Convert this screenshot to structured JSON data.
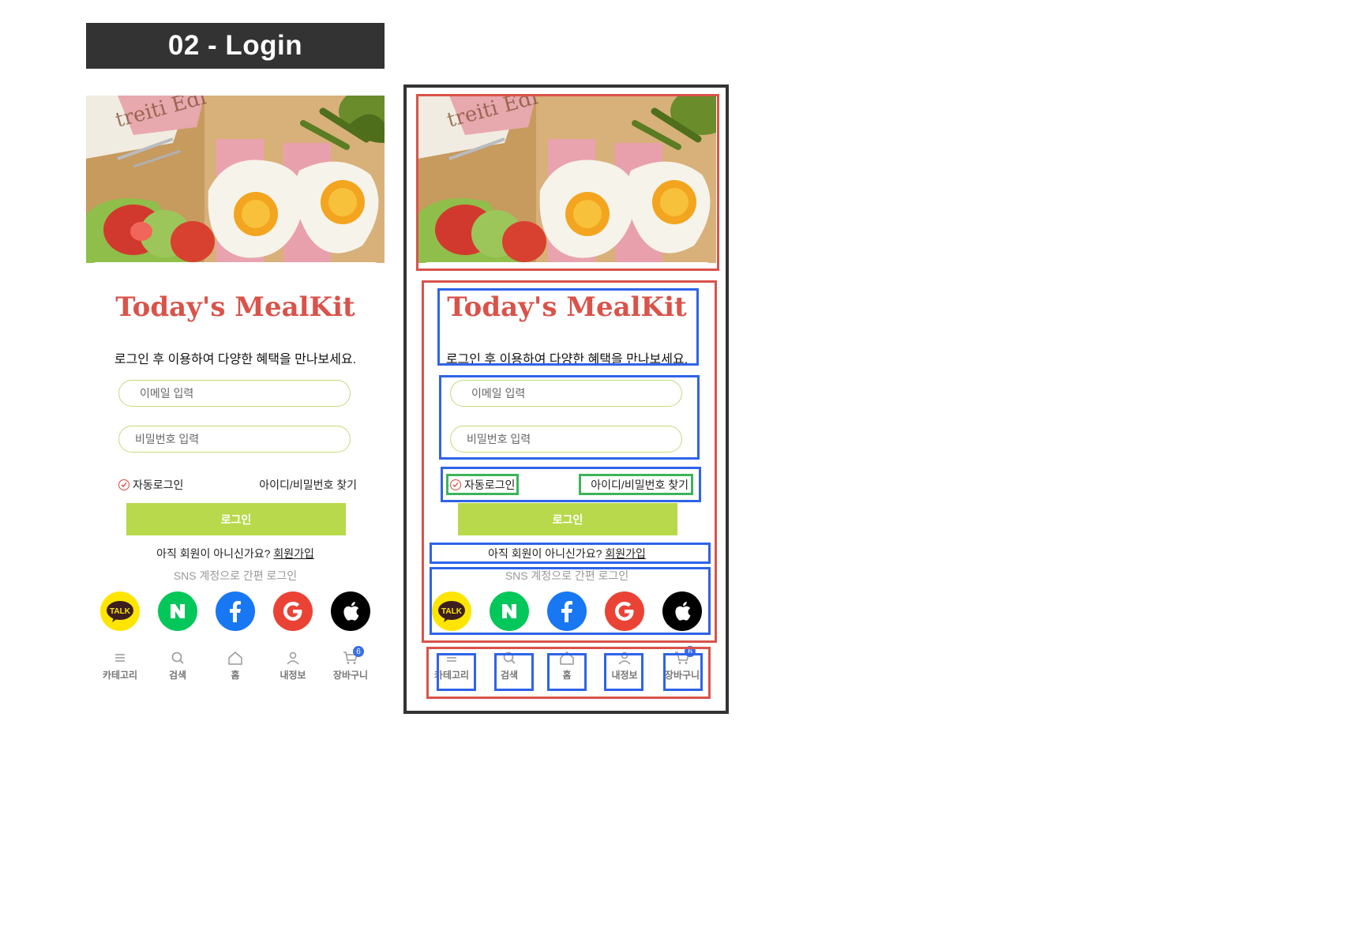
{
  "page": {
    "title": "02 - Login"
  },
  "login": {
    "brand": "Today's MealKit",
    "subtitle": "로그인 후 이용하여 다양한 혜택을 만나보세요.",
    "email_placeholder": "이메일 입력",
    "password_placeholder": "비밀번호 입력",
    "auto_login_label": "자동로그인",
    "find_account_label": "아이디/비밀번호 찾기",
    "login_button_label": "로그인",
    "signup_prompt": "아직 회원이 아니신가요?",
    "signup_link": "회원가입",
    "sns_caption": "SNS 계정으로 간편 로그인",
    "sns": [
      {
        "name": "kakao",
        "icon": "kakao-talk-icon",
        "text": "TALK",
        "color": "#fee500"
      },
      {
        "name": "naver",
        "icon": "naver-icon",
        "text": "N",
        "color": "#03c75a"
      },
      {
        "name": "facebook",
        "icon": "facebook-icon",
        "text": "f",
        "color": "#1877f2"
      },
      {
        "name": "google",
        "icon": "google-icon",
        "text": "G",
        "color": "#ea4335"
      },
      {
        "name": "apple",
        "icon": "apple-icon",
        "color": "#000000"
      }
    ]
  },
  "tabbar": {
    "items": [
      {
        "label": "카테고리",
        "icon": "menu-icon"
      },
      {
        "label": "검색",
        "icon": "search-icon"
      },
      {
        "label": "홈",
        "icon": "home-icon"
      },
      {
        "label": "내정보",
        "icon": "user-icon"
      },
      {
        "label": "장바구니",
        "icon": "cart-icon",
        "badge": "6"
      }
    ]
  },
  "colors": {
    "brand": "#d9534a",
    "accent": "#b9d94c",
    "input_border": "#c6d97a",
    "header_bg": "#333333",
    "annotation_red": "#d9534a",
    "annotation_blue": "#2f63e8",
    "annotation_green": "#3cb45a"
  }
}
